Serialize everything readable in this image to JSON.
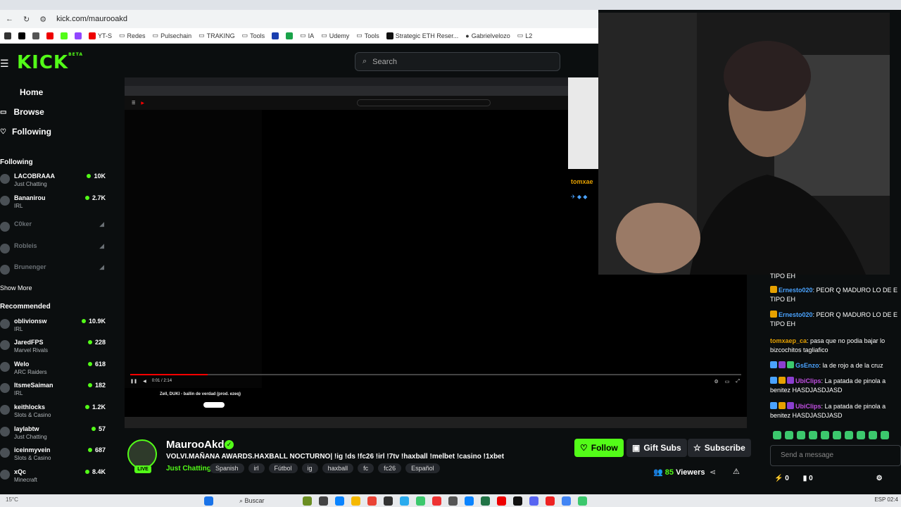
{
  "browser": {
    "url": "kick.com/maurooakd",
    "bookmarks": [
      "YT-S",
      "Redes",
      "Pulsechain",
      "TRAKING",
      "Tools",
      "IA",
      "Udemy",
      "Tools",
      "Strategic ETH Reser...",
      "Gabrielvelozo",
      "L2"
    ]
  },
  "header": {
    "logo": "KICK",
    "logo_sup": "BETA",
    "search_placeholder": "Search"
  },
  "sidebar": {
    "nav": [
      "Home",
      "Browse",
      "Following"
    ],
    "following_title": "Following",
    "following": [
      {
        "name": "LACOBRAAA",
        "category": "Just Chatting",
        "viewers": "10K",
        "live": true
      },
      {
        "name": "Bananirou",
        "category": "IRL",
        "viewers": "2.7K",
        "live": true
      },
      {
        "name": "C0ker",
        "category": "",
        "viewers": "",
        "live": false
      },
      {
        "name": "Robleis",
        "category": "",
        "viewers": "",
        "live": false
      },
      {
        "name": "Brunenger",
        "category": "",
        "viewers": "",
        "live": false
      }
    ],
    "show_more": "Show More",
    "recommended_title": "Recommended",
    "recommended": [
      {
        "name": "oblivionsw",
        "category": "IRL",
        "viewers": "10.9K"
      },
      {
        "name": "JaredFPS",
        "category": "Marvel Rivals",
        "viewers": "228"
      },
      {
        "name": "Welo",
        "category": "ARC Raiders",
        "viewers": "618"
      },
      {
        "name": "ItsmeSaiman",
        "category": "IRL",
        "viewers": "182"
      },
      {
        "name": "keithlocks",
        "category": "Slots & Casino",
        "viewers": "1.2K"
      },
      {
        "name": "laylabtw",
        "category": "Just Chatting",
        "viewers": "57"
      },
      {
        "name": "iceinmyvein",
        "category": "Slots & Casino",
        "viewers": "687"
      },
      {
        "name": "xQc",
        "category": "Minecraft",
        "viewers": "8.4K"
      }
    ]
  },
  "player": {
    "inner_title": "Zell, DUKI - ballin de verdad (prod. ezeq)",
    "overlay_user": "tomxae",
    "time": "0:01 / 2:14"
  },
  "streamer": {
    "name": "MaurooAkd",
    "live_label": "LIVE",
    "title": "VOLVI.MAÑANA AWARDS.HAXBALL NOCTURNO| !ig !ds !fc26 !irl !7tv !haxball !melbet !casino !1xbet",
    "category": "Just Chatting",
    "tags": [
      "Spanish",
      "irl",
      "Fútbol",
      "ig",
      "haxball",
      "fc",
      "fc26",
      "Español"
    ],
    "follow": "Follow",
    "gift": "Gift Subs",
    "subscribe": "Subscribe",
    "viewers": "85",
    "viewers_label": "Viewers"
  },
  "chat": {
    "messages": [
      {
        "user": "",
        "text": "TIPO EH",
        "color": "#ffffff"
      },
      {
        "user": "Ernesto020",
        "text": ": PEOR Q MADURO LO DE E TIPO EH",
        "color": "#4aa3ff"
      },
      {
        "user": "Ernesto020",
        "text": ": PEOR Q MADURO LO DE E TIPO EH",
        "color": "#4aa3ff"
      },
      {
        "user": "tomxaep_ca",
        "text": ": pasa que no podia bajar lo bizcochitos tagliafico",
        "color": "#e6a100"
      },
      {
        "user": "GsEnzo",
        "text": ": la de rojo a de la cruz",
        "color": "#4aa3ff"
      },
      {
        "user": "UbiClips",
        "text": ": La patada de pinola a benitez HASDJASDJASD",
        "color": "#c04ee0"
      },
      {
        "user": "UbiClips",
        "text": ": La patada de pinola a benitez HASDJASDJASD",
        "color": "#c04ee0"
      }
    ],
    "input_placeholder": "Send a message",
    "points": "0",
    "drops": "0"
  },
  "taskbar": {
    "temp": "15°C",
    "search": "Buscar",
    "lang": "ESP",
    "time": "02:4"
  },
  "colors": {
    "accent": "#53fc18",
    "bg": "#0b0e0f"
  }
}
